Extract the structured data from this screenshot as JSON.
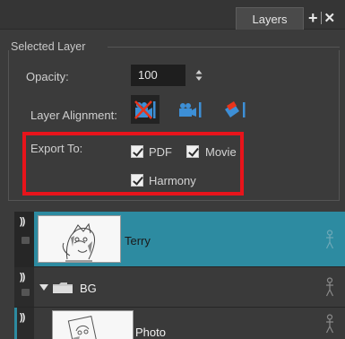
{
  "tabbar": {
    "tab_label": "Layers",
    "icons": [
      "plus-icon",
      "close-icon"
    ]
  },
  "selected_layer": {
    "title": "Selected Layer",
    "opacity_label": "Opacity:",
    "opacity_value": "100",
    "alignment_label": "Layer Alignment:",
    "alignment_options": [
      "align-camera-icon",
      "align-group-icon",
      "align-plane-icon"
    ],
    "alignment_selected": 0,
    "export_label": "Export To:",
    "export_options": [
      {
        "label": "PDF",
        "checked": true
      },
      {
        "label": "Movie",
        "checked": true
      },
      {
        "label": "Harmony",
        "checked": true
      }
    ]
  },
  "layers": [
    {
      "name": "Terry",
      "selected": true,
      "type": "drawing"
    },
    {
      "name": "BG",
      "selected": false,
      "type": "folder"
    },
    {
      "name": "Photo",
      "selected": false,
      "type": "image"
    }
  ],
  "colors": {
    "selection": "#2d8ba1",
    "highlight_box": "#e8141b",
    "panel_bg": "#3b3b3b"
  }
}
